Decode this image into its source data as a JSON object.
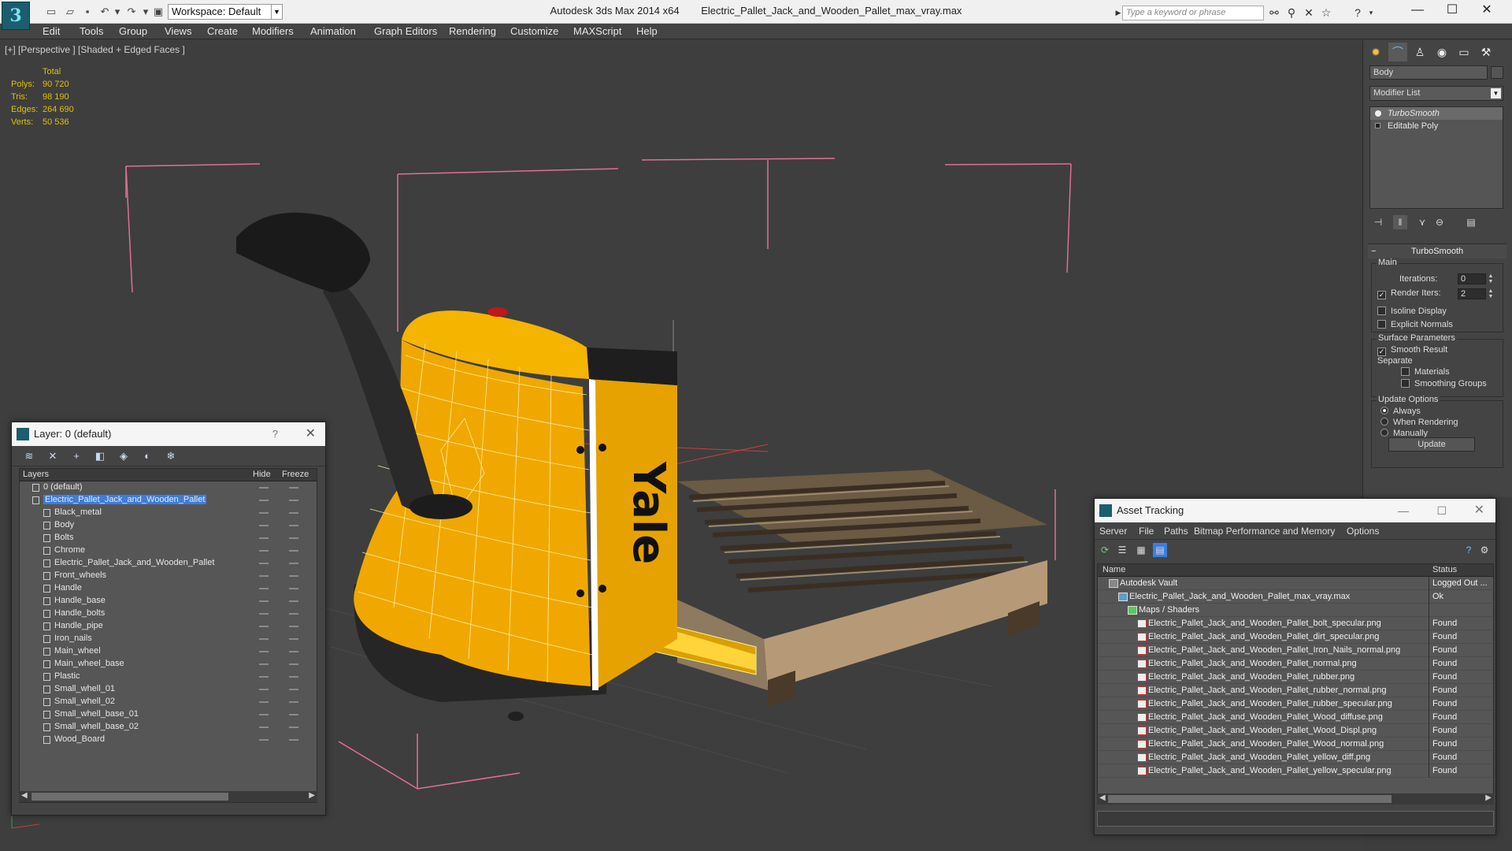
{
  "titlebar": {
    "workspace": "Workspace: Default",
    "app_name": "Autodesk 3ds Max  2014 x64",
    "file_name": "Electric_Pallet_Jack_and_Wooden_Pallet_max_vray.max",
    "search_placeholder": "Type a keyword or phrase"
  },
  "menu": [
    "Edit",
    "Tools",
    "Group",
    "Views",
    "Create",
    "Modifiers",
    "Animation",
    "Graph Editors",
    "Rendering",
    "Customize",
    "MAXScript",
    "Help"
  ],
  "viewport": {
    "label": "[+] [Perspective ] [Shaded + Edged Faces ]",
    "stats": {
      "title": "Total",
      "polys_label": "Polys:",
      "polys": "90 720",
      "tris_label": "Tris:",
      "tris": "98 190",
      "edges_label": "Edges:",
      "edges": "264 690",
      "verts_label": "Verts:",
      "verts": "50 536"
    },
    "brand_text": "Yale"
  },
  "layer_dialog": {
    "title": "Layer: 0 (default)",
    "help": "?",
    "col_layers": "Layers",
    "col_hide": "Hide",
    "col_freeze": "Freeze",
    "layers": [
      {
        "name": "0 (default)",
        "level": 1,
        "type": "layer"
      },
      {
        "name": "Electric_Pallet_Jack_and_Wooden_Pallet",
        "level": 1,
        "type": "layer",
        "selected": true
      },
      {
        "name": "Black_metal",
        "level": 2,
        "type": "object"
      },
      {
        "name": "Body",
        "level": 2,
        "type": "object"
      },
      {
        "name": "Bolts",
        "level": 2,
        "type": "object"
      },
      {
        "name": "Chrome",
        "level": 2,
        "type": "object"
      },
      {
        "name": "Electric_Pallet_Jack_and_Wooden_Pallet",
        "level": 2,
        "type": "object"
      },
      {
        "name": "Front_wheels",
        "level": 2,
        "type": "object"
      },
      {
        "name": "Handle",
        "level": 2,
        "type": "object"
      },
      {
        "name": "Handle_base",
        "level": 2,
        "type": "object"
      },
      {
        "name": "Handle_bolts",
        "level": 2,
        "type": "object"
      },
      {
        "name": "Handle_pipe",
        "level": 2,
        "type": "object"
      },
      {
        "name": "Iron_nails",
        "level": 2,
        "type": "object"
      },
      {
        "name": "Main_wheel",
        "level": 2,
        "type": "object"
      },
      {
        "name": "Main_wheel_base",
        "level": 2,
        "type": "object"
      },
      {
        "name": "Plastic",
        "level": 2,
        "type": "object"
      },
      {
        "name": "Small_whell_01",
        "level": 2,
        "type": "object"
      },
      {
        "name": "Small_whell_02",
        "level": 2,
        "type": "object"
      },
      {
        "name": "Small_whell_base_01",
        "level": 2,
        "type": "object"
      },
      {
        "name": "Small_whell_base_02",
        "level": 2,
        "type": "object"
      },
      {
        "name": "Wood_Board",
        "level": 2,
        "type": "object"
      }
    ]
  },
  "command_panel": {
    "object_name": "Body",
    "modifier_list": "Modifier List",
    "stack": [
      {
        "name": "TurboSmooth",
        "kind": "modifier"
      },
      {
        "name": "Editable Poly",
        "kind": "base"
      }
    ],
    "turbosmooth": {
      "title": "TurboSmooth",
      "main_label": "Main",
      "iterations_label": "Iterations:",
      "iterations": "0",
      "render_iters_label": "Render Iters:",
      "render_iters": "2",
      "isoline": "Isoline Display",
      "explicit": "Explicit Normals",
      "surface_label": "Surface Parameters",
      "smooth_result": "Smooth Result",
      "separate_label": "Separate",
      "materials": "Materials",
      "smoothing_groups": "Smoothing Groups",
      "update_label": "Update Options",
      "always": "Always",
      "when_rendering": "When Rendering",
      "manually": "Manually",
      "update_btn": "Update"
    }
  },
  "asset_tracking": {
    "title": "Asset Tracking",
    "menu": [
      "Server",
      "File",
      "Paths",
      "Bitmap Performance and Memory",
      "Options"
    ],
    "col_name": "Name",
    "col_status": "Status",
    "rows": [
      {
        "name": "Autodesk Vault",
        "status": "Logged Out ...",
        "level": 0,
        "icon": "vault"
      },
      {
        "name": "Electric_Pallet_Jack_and_Wooden_Pallet_max_vray.max",
        "status": "Ok",
        "level": 1,
        "icon": "max"
      },
      {
        "name": "Maps / Shaders",
        "status": "",
        "level": 2,
        "icon": "maps"
      },
      {
        "name": "Electric_Pallet_Jack_and_Wooden_Pallet_bolt_specular.png",
        "status": "Found",
        "level": 3,
        "icon": "png"
      },
      {
        "name": "Electric_Pallet_Jack_and_Wooden_Pallet_dirt_specular.png",
        "status": "Found",
        "level": 3,
        "icon": "png"
      },
      {
        "name": "Electric_Pallet_Jack_and_Wooden_Pallet_Iron_Nails_normal.png",
        "status": "Found",
        "level": 3,
        "icon": "png"
      },
      {
        "name": "Electric_Pallet_Jack_and_Wooden_Pallet_normal.png",
        "status": "Found",
        "level": 3,
        "icon": "png"
      },
      {
        "name": "Electric_Pallet_Jack_and_Wooden_Pallet_rubber.png",
        "status": "Found",
        "level": 3,
        "icon": "png"
      },
      {
        "name": "Electric_Pallet_Jack_and_Wooden_Pallet_rubber_normal.png",
        "status": "Found",
        "level": 3,
        "icon": "png"
      },
      {
        "name": "Electric_Pallet_Jack_and_Wooden_Pallet_rubber_specular.png",
        "status": "Found",
        "level": 3,
        "icon": "png"
      },
      {
        "name": "Electric_Pallet_Jack_and_Wooden_Pallet_Wood_diffuse.png",
        "status": "Found",
        "level": 3,
        "icon": "png"
      },
      {
        "name": "Electric_Pallet_Jack_and_Wooden_Pallet_Wood_Displ.png",
        "status": "Found",
        "level": 3,
        "icon": "png"
      },
      {
        "name": "Electric_Pallet_Jack_and_Wooden_Pallet_Wood_normal.png",
        "status": "Found",
        "level": 3,
        "icon": "png"
      },
      {
        "name": "Electric_Pallet_Jack_and_Wooden_Pallet_yellow_diff.png",
        "status": "Found",
        "level": 3,
        "icon": "png"
      },
      {
        "name": "Electric_Pallet_Jack_and_Wooden_Pallet_yellow_specular.png",
        "status": "Found",
        "level": 3,
        "icon": "png"
      }
    ]
  },
  "colors": {
    "accent": "#3d7ddb",
    "stats_text": "#e0c000",
    "body_yellow": "#f0a800",
    "bbox_pink": "#e07090"
  }
}
